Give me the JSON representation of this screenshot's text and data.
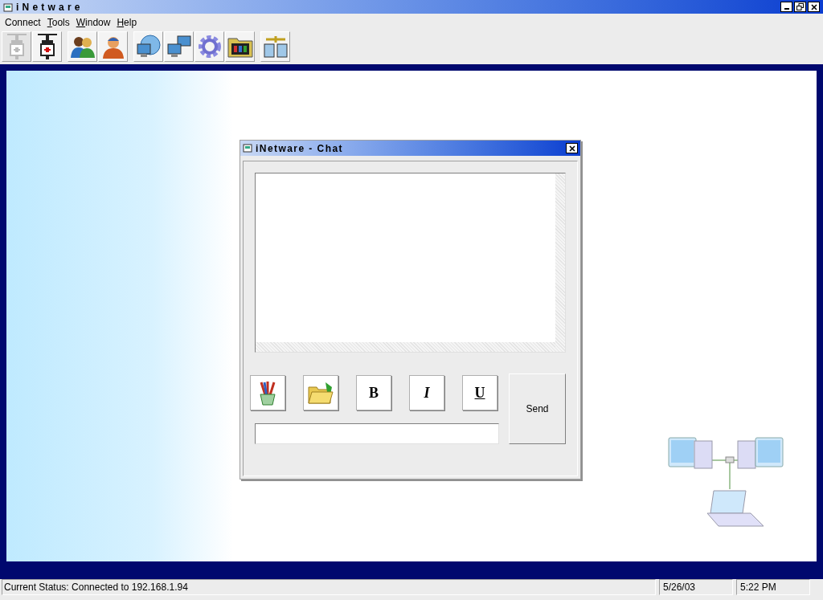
{
  "window": {
    "title": "iNetware"
  },
  "menu": [
    {
      "label": "Connect",
      "mnemonic": false
    },
    {
      "label": "Tools",
      "mnemonic": true
    },
    {
      "label": "Window",
      "mnemonic": true
    },
    {
      "label": "Help",
      "mnemonic": true
    }
  ],
  "toolbar": {
    "groups": [
      [
        {
          "kind": "plug",
          "disabled": true
        },
        {
          "kind": "plug",
          "disabled": false
        }
      ],
      [
        {
          "kind": "people",
          "disabled": false
        },
        {
          "kind": "person",
          "disabled": false
        }
      ],
      [
        {
          "kind": "globe",
          "disabled": false
        },
        {
          "kind": "computers",
          "disabled": false
        },
        {
          "kind": "gear",
          "disabled": false
        },
        {
          "kind": "folder-media",
          "disabled": false
        }
      ],
      [
        {
          "kind": "network",
          "disabled": false
        }
      ]
    ]
  },
  "chat": {
    "title": "iNetware - Chat",
    "format_buttons": [
      {
        "kind": "pens"
      },
      {
        "kind": "folder"
      },
      {
        "kind": "bold",
        "label": "B"
      },
      {
        "kind": "italic",
        "label": "I"
      },
      {
        "kind": "underline",
        "label": "U"
      }
    ],
    "send": "Send"
  },
  "status_bar": [
    "Current Status: Connected to 192.168.1.94",
    "5/26/03",
    "5:22 PM"
  ]
}
